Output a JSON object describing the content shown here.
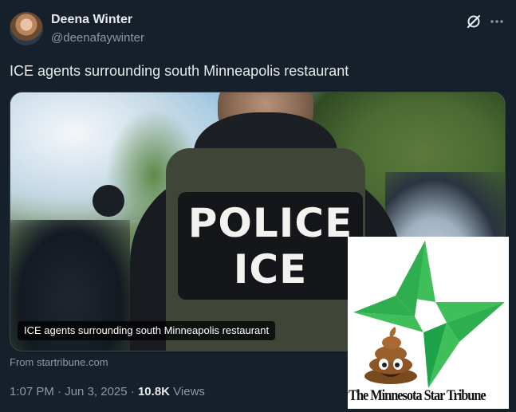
{
  "tweet": {
    "author_name": "Deena Winter",
    "author_handle": "@deenafaywinter",
    "text": "ICE agents surrounding south Minneapolis restaurant",
    "time": "1:07 PM",
    "separator1": "·",
    "date": "Jun 3, 2025",
    "separator2": "·",
    "views_count": "10.8K",
    "views_label": "Views"
  },
  "media": {
    "patch_line1": "POLICE",
    "patch_line2": "ICE",
    "caption": "ICE agents surrounding south Minneapolis restaurant",
    "source": "From startribune.com"
  },
  "overlay_logo": {
    "text": "The Minnesota Star Tribune",
    "star_colors": [
      "#3fbf5a",
      "#1fa34a"
    ],
    "emoji": "pile-of-poo"
  },
  "icons": {
    "grok": "grok-icon",
    "more": "more-dots-icon"
  }
}
